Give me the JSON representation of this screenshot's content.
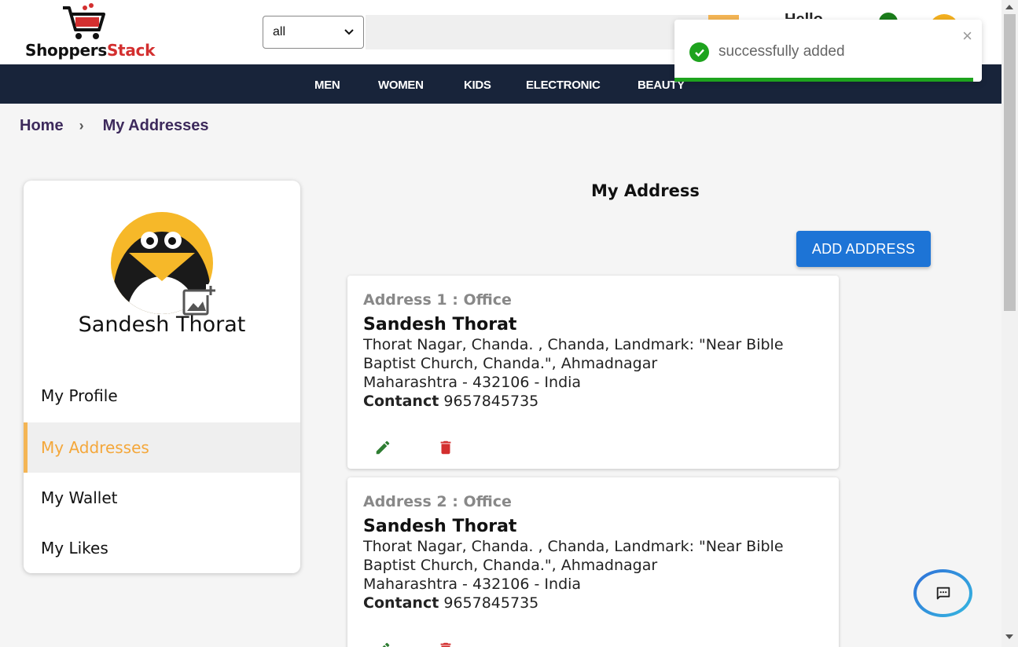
{
  "brand": {
    "name_part1": "Shoppers",
    "name_part2": "Stack"
  },
  "search": {
    "category": "all"
  },
  "header": {
    "greeting": "Hello"
  },
  "nav": [
    "MEN",
    "WOMEN",
    "KIDS",
    "ELECTRONIC",
    "BEAUTY"
  ],
  "toast": {
    "message": "successfully added",
    "close": "×"
  },
  "breadcrumb": {
    "home": "Home",
    "separator": "›",
    "current": "My Addresses"
  },
  "profile": {
    "name": "Sandesh Thorat"
  },
  "menu": [
    {
      "label": "My Profile"
    },
    {
      "label": "My Addresses"
    },
    {
      "label": "My Wallet"
    },
    {
      "label": "My Likes"
    }
  ],
  "main": {
    "title": "My Address",
    "add_button": "ADD ADDRESS"
  },
  "addresses": [
    {
      "label": "Address 1 :   Office",
      "name": "Sandesh Thorat",
      "line1": "Thorat Nagar, Chanda. , Chanda, Landmark: \"Near Bible",
      "line2": "Baptist Church, Chanda.\", Ahmadnagar",
      "line3": "Maharashtra - 432106 - India",
      "contact_label": "Contanct",
      "contact": "9657845735"
    },
    {
      "label": "Address 2 :   Office",
      "name": "Sandesh Thorat",
      "line1": "Thorat Nagar, Chanda. , Chanda, Landmark: \"Near Bible",
      "line2": "Baptist Church, Chanda.\", Ahmadnagar",
      "line3": "Maharashtra - 432106 - India",
      "contact_label": "Contanct",
      "contact": "9657845735"
    }
  ],
  "colors": {
    "accent": "#f4b555",
    "nav_bg": "#18243a",
    "primary": "#1d74d6",
    "success": "#1ea31e"
  }
}
